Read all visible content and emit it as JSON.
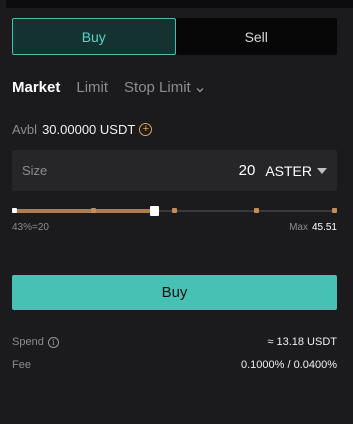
{
  "side_toggle": {
    "buy_label": "Buy",
    "sell_label": "Sell"
  },
  "order_types": {
    "market": "Market",
    "limit": "Limit",
    "stop_limit": "Stop Limit",
    "active": "Market",
    "stop_limit_icon": "chevron-down-icon"
  },
  "available": {
    "label": "Avbl",
    "value": "30.00000 USDT",
    "icon": "plus-circle-icon"
  },
  "size": {
    "label": "Size",
    "value": "20",
    "unit": "ASTER",
    "unit_icon": "caret-down-icon"
  },
  "slider": {
    "fraction": 0.43,
    "left_label": "43%=20",
    "max_label": "Max",
    "max_value": "45.51"
  },
  "submit": {
    "label": "Buy"
  },
  "spend": {
    "label": "Spend",
    "value": "≈ 13.18 USDT",
    "icon": "info-icon"
  },
  "fee": {
    "label": "Fee",
    "value": "0.1000% / 0.0400%"
  },
  "colors": {
    "buy_accent": "#47c1b4",
    "slider_accent": "#c48e5c",
    "info_accent": "#e0a24a"
  }
}
